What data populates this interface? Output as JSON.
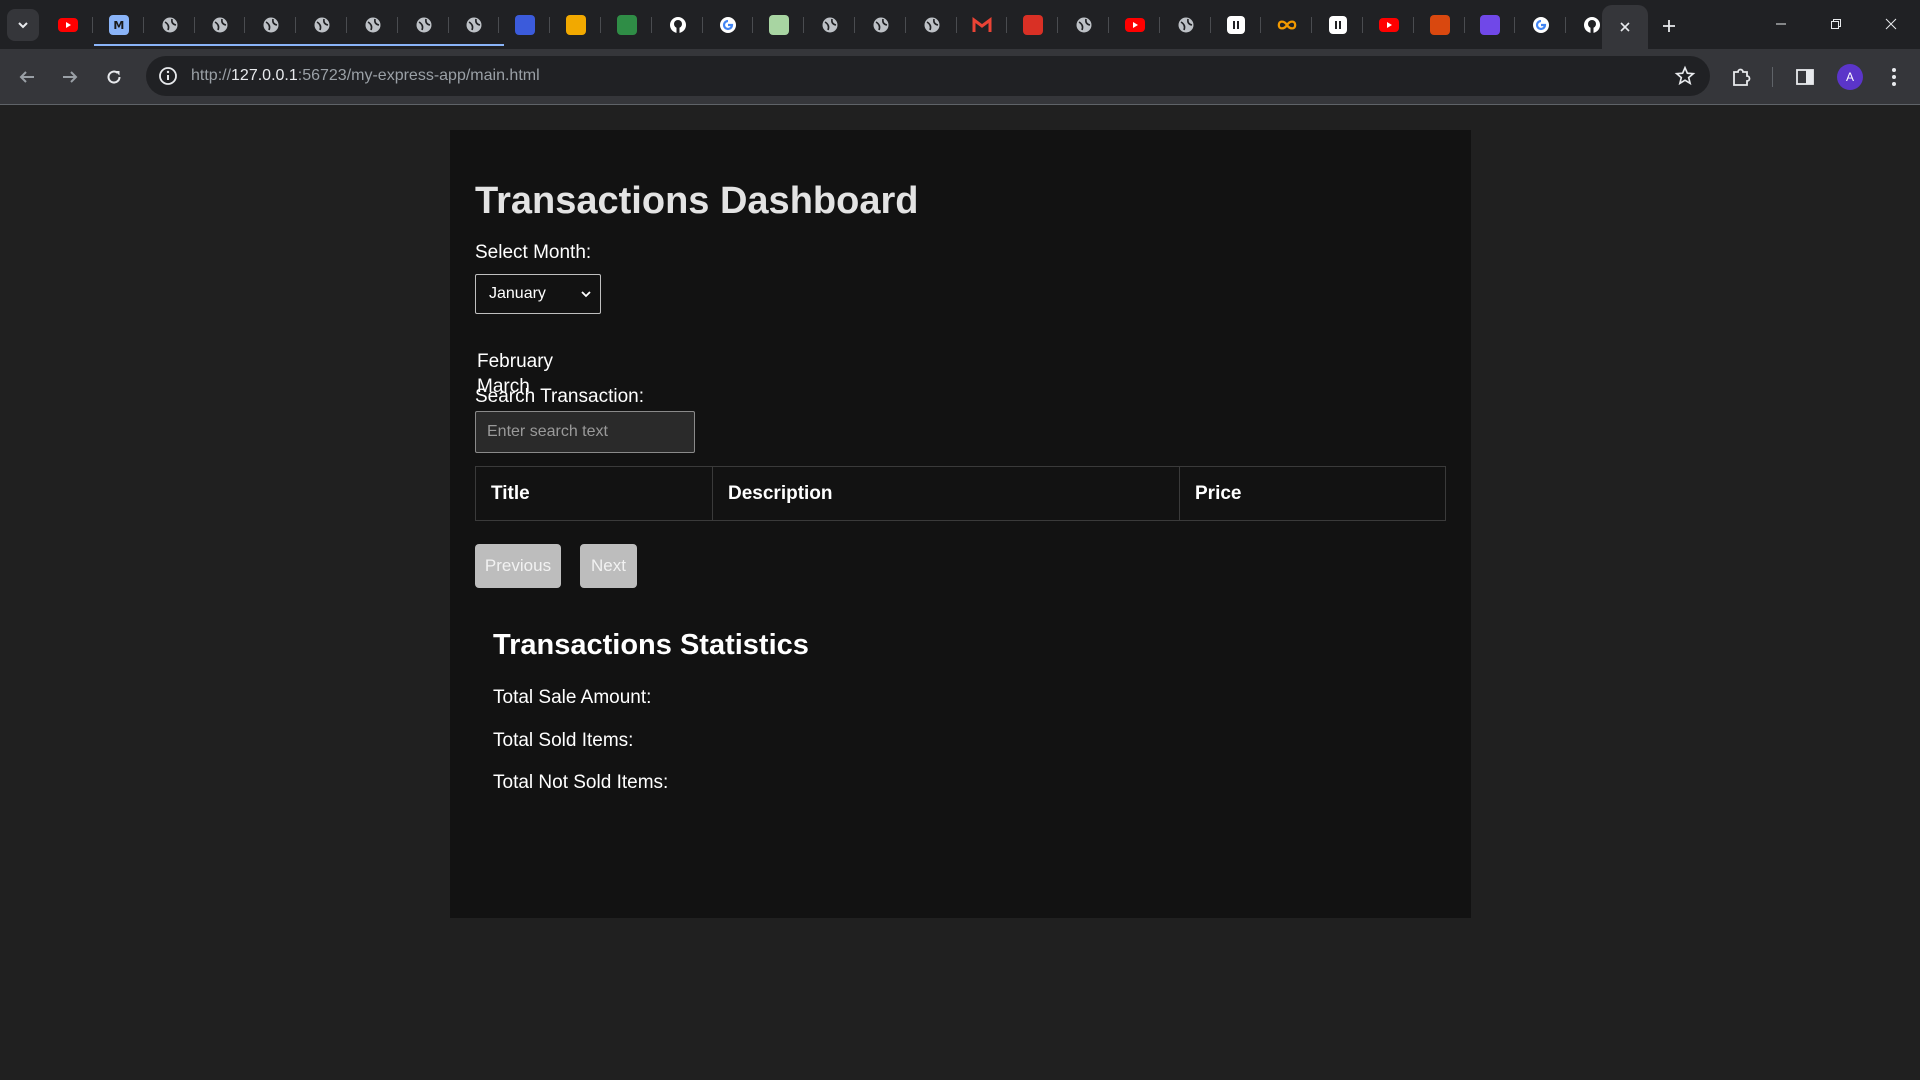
{
  "browser": {
    "url_prefix": "http://",
    "url_host": "127.0.0.1",
    "url_rest": ":56723/my-express-app/main.html",
    "avatar_letter": "A",
    "tabs": [
      {
        "icon": "youtube-icon",
        "color": "#ff0000"
      },
      {
        "icon": "m-icon",
        "color": "#8ab4f8",
        "letter": "M"
      },
      {
        "icon": "globe-icon",
        "color": "#bdc1c6"
      },
      {
        "icon": "globe-icon",
        "color": "#bdc1c6"
      },
      {
        "icon": "globe-icon",
        "color": "#bdc1c6"
      },
      {
        "icon": "globe-icon",
        "color": "#bdc1c6"
      },
      {
        "icon": "globe-icon",
        "color": "#bdc1c6"
      },
      {
        "icon": "globe-icon",
        "color": "#bdc1c6"
      },
      {
        "icon": "globe-icon",
        "color": "#bdc1c6"
      },
      {
        "icon": "flag-icon",
        "color": "#3b5bdb"
      },
      {
        "icon": "pyramid-icon",
        "color": "#f2a900"
      },
      {
        "icon": "gfg-icon",
        "color": "#2f8d46"
      },
      {
        "icon": "github-icon",
        "color": "#ffffff"
      },
      {
        "icon": "google-icon",
        "color": "#4285f4"
      },
      {
        "icon": "sheet-icon",
        "color": "#a8d5a2"
      },
      {
        "icon": "globe-icon",
        "color": "#bdc1c6"
      },
      {
        "icon": "globe-icon",
        "color": "#bdc1c6"
      },
      {
        "icon": "globe-icon",
        "color": "#bdc1c6"
      },
      {
        "icon": "gmail-icon",
        "color": "#ea4335"
      },
      {
        "icon": "figure-icon",
        "color": "#d93025"
      },
      {
        "icon": "globe-icon",
        "color": "#bdc1c6"
      },
      {
        "icon": "youtube-icon",
        "color": "#ff0000"
      },
      {
        "icon": "globe-icon",
        "color": "#bdc1c6"
      },
      {
        "icon": "notion-icon",
        "color": "#ffffff"
      },
      {
        "icon": "infinity-icon",
        "color": "#f29900"
      },
      {
        "icon": "ta-icon",
        "color": "#ffffff"
      },
      {
        "icon": "youtube-icon",
        "color": "#ff0000"
      },
      {
        "icon": "check-icon",
        "color": "#d9480f"
      },
      {
        "icon": "list-icon",
        "color": "#7048e8"
      },
      {
        "icon": "google-icon",
        "color": "#4285f4"
      },
      {
        "icon": "github-icon",
        "color": "#ffffff"
      }
    ]
  },
  "page": {
    "title": "Transactions Dashboard",
    "month_label": "Select Month:",
    "month_selected": "January",
    "month_options_visible": [
      "February",
      "March"
    ],
    "search_label": "Search Transaction:",
    "search_placeholder": "Enter search text",
    "table_headers": [
      "Title",
      "Description",
      "Price"
    ],
    "prev_label": "Previous",
    "next_label": "Next",
    "stats_title": "Transactions Statistics",
    "stats": [
      "Total Sale Amount:",
      "Total Sold Items:",
      "Total Not Sold Items:"
    ]
  }
}
